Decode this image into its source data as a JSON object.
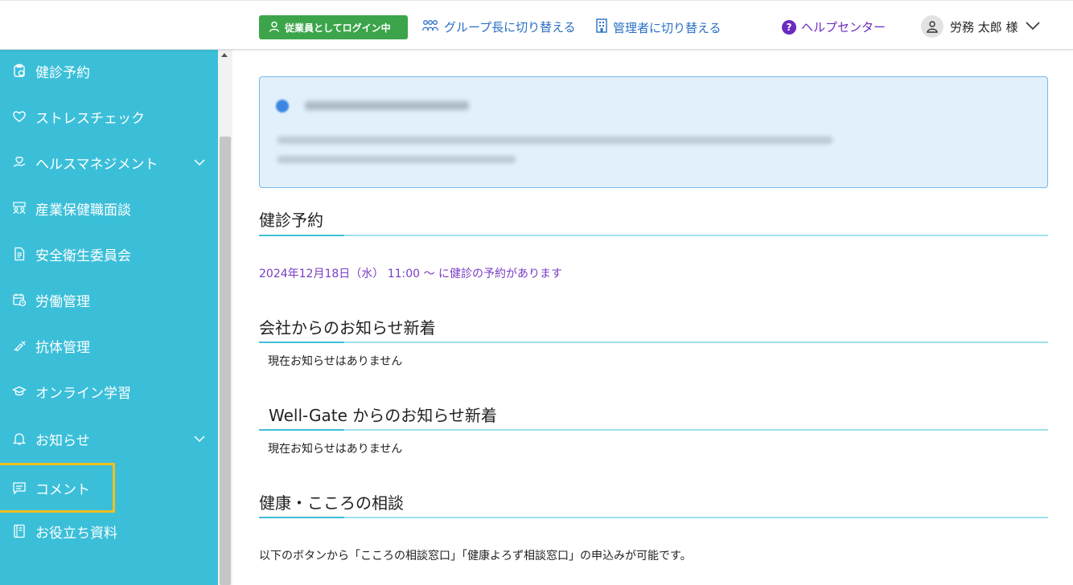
{
  "header": {
    "login_badge": "従業員としてログイン中",
    "switch_group": "グループ長に切り替える",
    "switch_admin": "管理者に切り替える",
    "help_center": "ヘルプセンター",
    "user_name": "労務 太郎 様"
  },
  "sidebar": {
    "items": [
      {
        "label": "健診予約",
        "icon": "clipboard-icon"
      },
      {
        "label": "ストレスチェック",
        "icon": "heart-icon"
      },
      {
        "label": "ヘルスマネジメント",
        "icon": "health-management-icon"
      },
      {
        "label": "産業保健職面談",
        "icon": "people-interview-icon"
      },
      {
        "label": "安全衛生委員会",
        "icon": "document-icon"
      },
      {
        "label": "労働管理",
        "icon": "calendar-clock-icon"
      },
      {
        "label": "抗体管理",
        "icon": "syringe-icon"
      },
      {
        "label": "オンライン学習",
        "icon": "graduation-cap-icon"
      },
      {
        "label": "お知らせ",
        "icon": "bell-icon"
      },
      {
        "label": "コメント",
        "icon": "comment-icon"
      },
      {
        "label": "お役立ち資料",
        "icon": "book-icon"
      }
    ]
  },
  "main": {
    "sections": {
      "checkup": {
        "title": "健診予約",
        "reservation": "2024年12月18日（水） 11:00 〜 に健診の予約があります"
      },
      "company_news": {
        "title": "会社からのお知らせ新着",
        "empty": "現在お知らせはありません"
      },
      "wellgate_news": {
        "title": "Well-Gate からのお知らせ新着",
        "empty": "現在お知らせはありません"
      },
      "consult": {
        "title": "健康・こころの相談",
        "text": "以下のボタンから「こころの相談窓口」「健康よろず相談窓口」の申込みが可能です。"
      }
    }
  },
  "colors": {
    "sidebar": "#3bbfd9",
    "login_badge": "#3ca54b",
    "link": "#2a6fc4",
    "help": "#6a2bbf",
    "reservation_text": "#7a3cc6",
    "highlight": "#f2c01e"
  }
}
